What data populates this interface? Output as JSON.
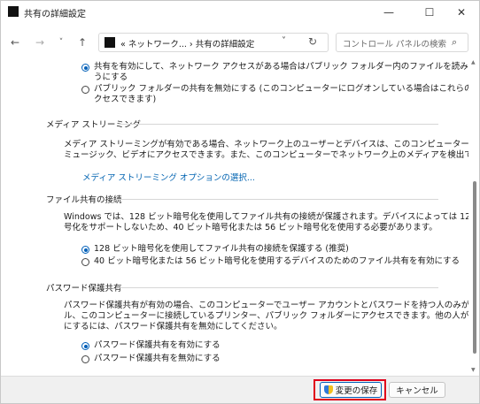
{
  "window": {
    "title": "共有の詳細設定"
  },
  "title_controls": {
    "minimize": "—",
    "maximize": "☐",
    "close": "✕"
  },
  "nav": {
    "back": "←",
    "forward": "→",
    "recent": "˅",
    "up": "↑"
  },
  "address": {
    "path": "«  ネットワーク...  ›  共有の詳細設定",
    "chevron": "˅",
    "refresh": "↻"
  },
  "search": {
    "placeholder": "コントロール パネルの検索",
    "icon": "⌕"
  },
  "sections": {
    "public_folder": {
      "option1_line1": "共有を有効にして、ネットワーク アクセスがある場合はパブリック フォルダー内のファイルを読み書きできるよ",
      "option1_line2": "うにする",
      "option2_line1": "パブリック フォルダーの共有を無効にする (このコンピューターにログオンしている場合はこれらのフォルダーにア",
      "option2_line2": "クセスできます)"
    },
    "media": {
      "heading": "メディア ストリーミング",
      "desc_line1": "メディア ストリーミングが有効である場合、ネットワーク上のユーザーとデバイスは、このコンピューター上のピクチャ、",
      "desc_line2": "ミュージック、ビデオにアクセスできます。また、このコンピューターでネットワーク上のメディアを検出できます。",
      "link": "メディア ストリーミング オプションの選択..."
    },
    "file_sharing": {
      "heading": "ファイル共有の接続",
      "desc_line1": "Windows では、128 ビット暗号化を使用してファイル共有の接続が保護されます。デバイスによっては 128 ビット暗",
      "desc_line2": "号化をサポートしないため、40 ビット暗号化または 56 ビット暗号化を使用する必要があります。",
      "option1": "128 ビット暗号化を使用してファイル共有の接続を保護する (推奨)",
      "option2": "40 ビット暗号化または 56 ビット暗号化を使用するデバイスのためのファイル共有を有効にする"
    },
    "password": {
      "heading": "パスワード保護共有",
      "desc_line1": "パスワード保護共有が有効の場合、このコンピューターでユーザー アカウントとパスワードを持つ人のみが、共有ファイ",
      "desc_line2": "ル、このコンピューターに接続しているプリンター、パブリック フォルダーにアクセスできます。他の人がアクセスできるよう",
      "desc_line3": "にするには、パスワード保護共有を無効にしてください。",
      "option1": "パスワード保護共有を有効にする",
      "option2": "パスワード保護共有を無効にする"
    }
  },
  "footer": {
    "save": "変更の保存",
    "cancel": "キャンセル"
  },
  "colors": {
    "accent": "#005fb8",
    "highlight": "#e0001b",
    "link": "#0063b1"
  }
}
